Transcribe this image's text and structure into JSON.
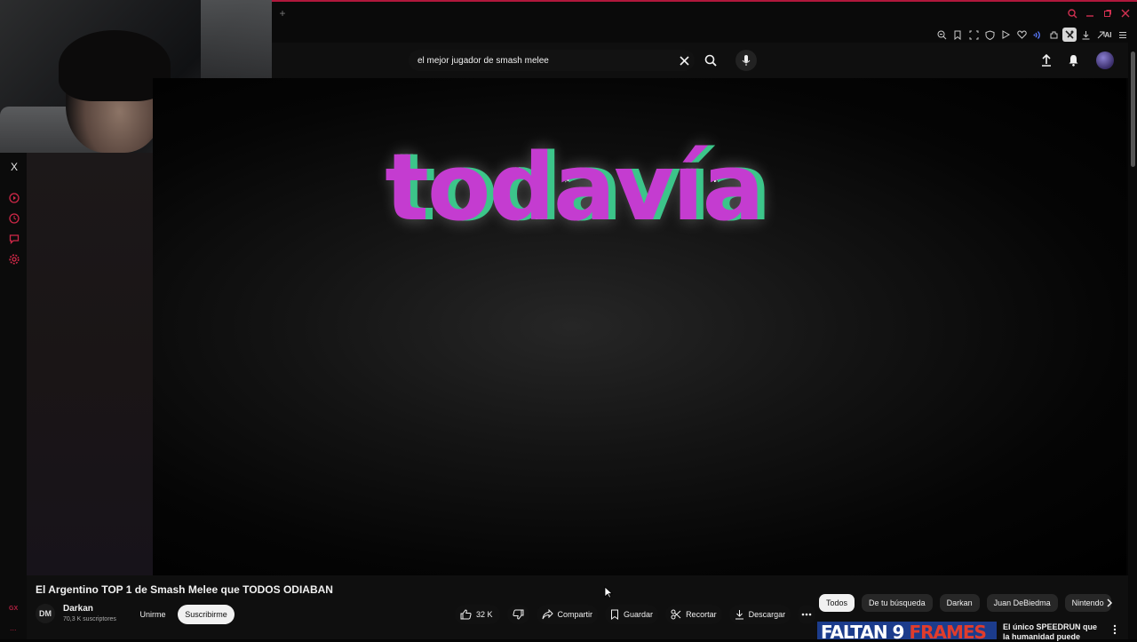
{
  "browser": {
    "new_tab_label": "+",
    "toolbar_icons": [
      "zoom-out-icon",
      "bookmark-icon",
      "snapshot-icon",
      "shield-icon",
      "play-icon",
      "heart-icon",
      "wifi-icon",
      "extensions-icon",
      "active-extension-icon",
      "download-icon",
      "ai-icon",
      "menu-icon"
    ],
    "ai_label": "AI",
    "accent": "#b0183c"
  },
  "sidebar": {
    "close_label": "X",
    "items": [
      "play-circle-icon",
      "history-icon",
      "chat-icon",
      "settings-icon"
    ],
    "bottom_labels": [
      "GX",
      "..."
    ]
  },
  "youtube": {
    "search": {
      "value": "el mejor jugador de smash melee"
    },
    "video": {
      "overlay_text": "todavía"
    },
    "title": "El Argentino TOP 1 de Smash Melee que TODOS ODIABAN",
    "channel": {
      "avatar_text": "DM",
      "name": "Darkan",
      "subscribers": "70,3 K suscriptores",
      "join_label": "Unirme",
      "subscribe_label": "Suscribirme"
    },
    "actions": {
      "likes": "32 K",
      "share": "Compartir",
      "save": "Guardar",
      "clip": "Recortar",
      "download": "Descargar"
    },
    "chips": [
      "Todos",
      "De tu búsqueda",
      "Darkan",
      "Juan DeBiedma",
      "Nintendo"
    ],
    "recommendation": {
      "thumb_text_white": "FALTAN 9",
      "thumb_text_red": "FRAMES",
      "title": "El único SPEEDRUN que la humanidad puede"
    }
  }
}
